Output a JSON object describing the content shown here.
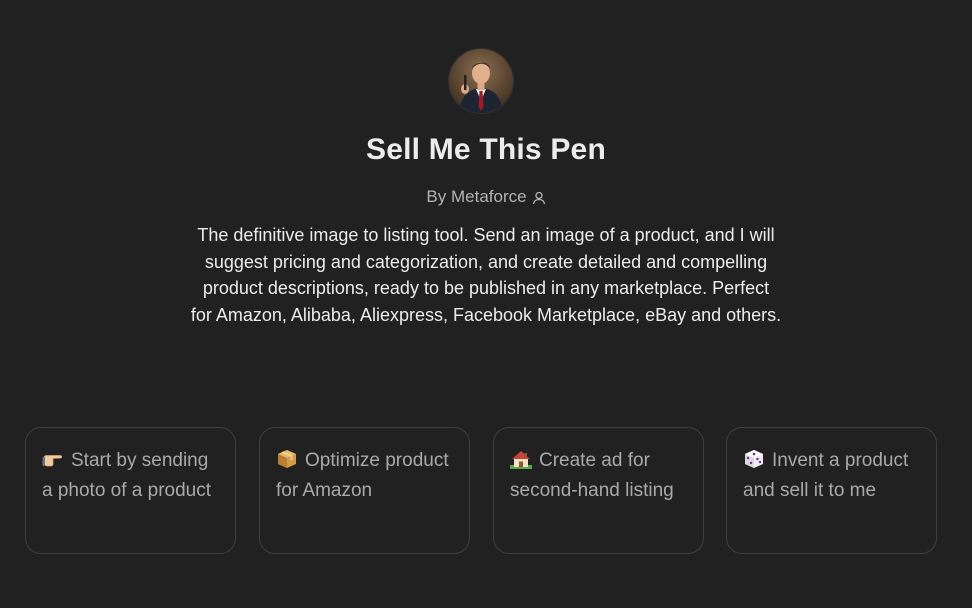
{
  "gpt": {
    "name": "Sell Me This Pen",
    "byline": "By Metaforce",
    "description": "The definitive image to listing tool. Send an image of a product, and I will suggest pricing and categorization, and create detailed and compelling product descriptions, ready to be published in any marketplace. Perfect for Amazon, Alibaba, Aliexpress, Facebook Marketplace, eBay and others."
  },
  "icons": {
    "avatar": "avatar",
    "byline": "person-icon"
  },
  "starters": [
    {
      "icon": "pointing-hand-icon",
      "label": "Start by sending a photo of a product"
    },
    {
      "icon": "package-icon",
      "label": "Optimize product for Amazon"
    },
    {
      "icon": "house-icon",
      "label": "Create ad for second-hand listing"
    },
    {
      "icon": "dice-icon",
      "label": "Invent a product and sell it to me"
    }
  ],
  "colors": {
    "background": "#212121",
    "text": "#ececec",
    "muted": "#b4b4b4",
    "card_border": "#3f3f3f"
  }
}
